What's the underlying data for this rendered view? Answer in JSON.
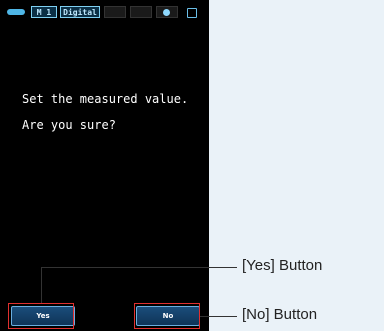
{
  "status_bar": {
    "mode_number": "M 1",
    "mode_name": "Digital"
  },
  "dialog": {
    "line1": "Set the measured value.",
    "line2": "Are you sure?"
  },
  "buttons": {
    "yes_label": "Yes",
    "no_label": "No"
  },
  "callouts": {
    "yes": "[Yes] Button",
    "no": "[No] Button"
  },
  "colors": {
    "screen_background": "#000000",
    "highlight": "#e0302f",
    "button_fill": "#1a4d7a",
    "accent": "#4fb6e6"
  },
  "icons": [
    "battery-icon",
    "indicator-dot-icon",
    "lock-icon"
  ]
}
